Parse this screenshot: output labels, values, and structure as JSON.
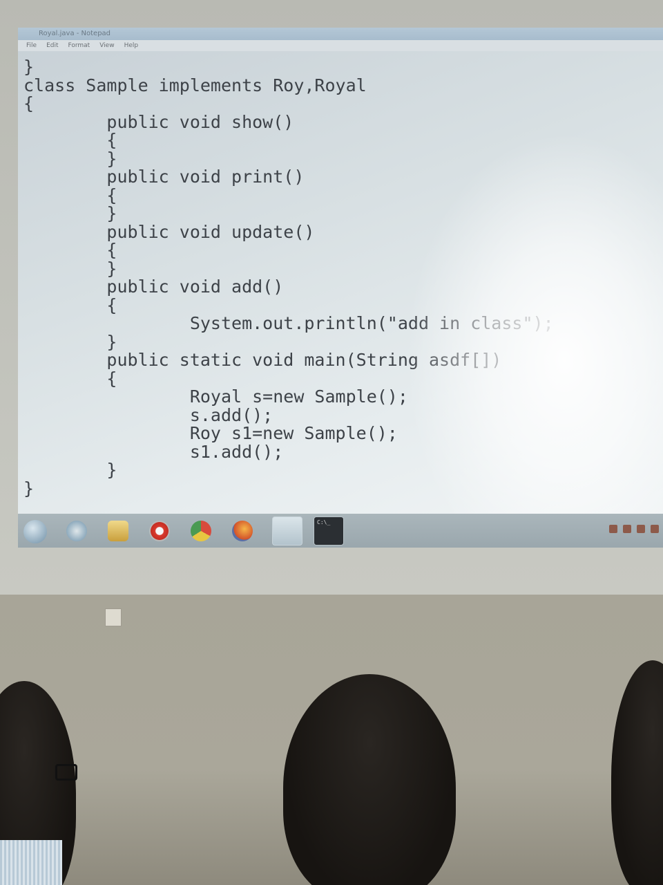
{
  "window": {
    "title": "Royal.java - Notepad",
    "menu": [
      "File",
      "Edit",
      "Format",
      "View",
      "Help"
    ]
  },
  "code_lines": [
    "}",
    "class Sample implements Roy,Royal",
    "{",
    "        public void show()",
    "        {",
    "        }",
    "        public void print()",
    "        {",
    "        }",
    "        public void update()",
    "        {",
    "        }",
    "        public void add()",
    "        {",
    "                System.out.println(\"add in class\");",
    "        }",
    "        public static void main(String asdf[])",
    "        {",
    "                Royal s=new Sample();",
    "                s.add();",
    "                Roy s1=new Sample();",
    "                s1.add();",
    "        }",
    "}"
  ],
  "taskbar": {
    "icons": [
      "start-orb-icon",
      "internet-explorer-icon",
      "folder-icon",
      "media-player-icon",
      "chrome-icon",
      "firefox-icon",
      "notepad-icon",
      "command-prompt-icon"
    ],
    "cmd_label": "C:\\_"
  },
  "colors": {
    "code_text": "#3d4248",
    "screen_background": "#e6ecee",
    "taskbar": "#9aa7ad"
  }
}
